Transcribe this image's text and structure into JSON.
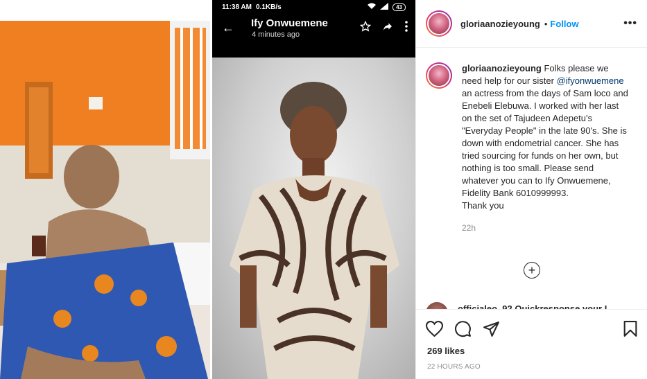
{
  "header": {
    "username": "gloriaanozieyoung",
    "dot": "•",
    "follow_label": "Follow",
    "more_label": "•••"
  },
  "media": {
    "phone_status": {
      "time": "11:38 AM",
      "speed": "0.1KB/s",
      "battery": "43"
    },
    "phone_header": {
      "back_icon": "←",
      "name": "Ify Onwuemene",
      "time": "4 minutes ago"
    }
  },
  "caption": {
    "username": "gloriaanozieyoung",
    "text_before_mention": " Folks please we need help for our sister ",
    "mention": "@ifyonwuemene",
    "text_after_mention": " an actress from the days of Sam loco and Enebeli Elebuwa. I worked with her last on the set of Tajudeen Adepetu's \"Everyday People\" in the late 90's. She is down with endometrial cancer. She has tried sourcing for funds on her own, but nothing is too small. Please send whatever you can to Ify Onwuemene, Fidelity Bank 6010999993.",
    "sign_off": "Thank you",
    "time": "22h"
  },
  "load_more_label": "+",
  "peek_comment": {
    "text": "officialeo_92 Quickresponse your I..."
  },
  "actions": {
    "likes": "269 likes",
    "posted": "22 HOURS AGO"
  },
  "colors": {
    "accent": "#0095f6",
    "text": "#262626",
    "muted": "#8e8e8e",
    "border": "#efefef"
  }
}
